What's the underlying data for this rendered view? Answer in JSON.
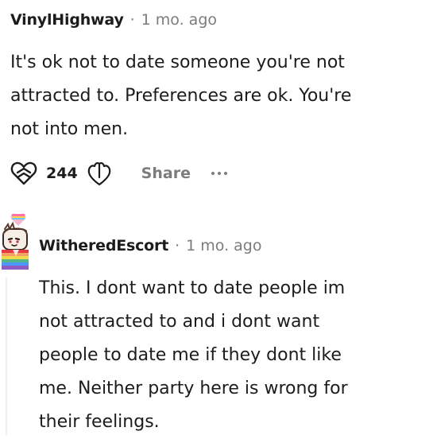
{
  "comments": [
    {
      "author": "VinylHighway",
      "separator": "·",
      "time": "1 mo. ago",
      "lines": [
        "It's ok not to date someone you're not",
        "attracted to. Preferences are ok. You're",
        "not into men."
      ],
      "votes": "244",
      "share_label": "Share",
      "icons": {
        "upvote": "upvote-heart-icon",
        "downvote": "downvote-heart-icon",
        "more": "more-dots-icon"
      }
    },
    {
      "author": "WitheredEscort",
      "separator": "·",
      "time": "1 mo. ago",
      "lines": [
        "This. I dont want to date people im",
        "not attracted to and i dont want",
        "people to date me if they dont like",
        "me. Neither party here is wrong for",
        "their feelings."
      ],
      "icons": {
        "avatar": "pride-avatar"
      }
    }
  ],
  "colors": {
    "text": "#1c1c1c",
    "meta": "#7c7c7c",
    "thread_line": "#edeff1"
  }
}
